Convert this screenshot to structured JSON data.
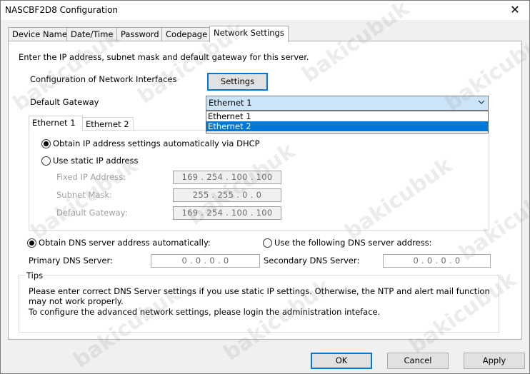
{
  "window": {
    "title": "NASCBF2D8 Configuration",
    "close_glyph": "✕"
  },
  "tabs": [
    {
      "label": "Device Name"
    },
    {
      "label": "Date/Time"
    },
    {
      "label": "Password"
    },
    {
      "label": "Codepage"
    },
    {
      "label": "Network Settings",
      "active": true
    }
  ],
  "network": {
    "intro": "Enter the IP address, subnet mask and default gateway for this server.",
    "interfaces_label": "Configuration of Network Interfaces",
    "settings_button": "Settings",
    "gateway_label": "Default Gateway",
    "gateway_selected": "Ethernet 1",
    "gateway_options": [
      "Ethernet 1",
      "Ethernet 2"
    ],
    "gateway_highlighted": "Ethernet 2"
  },
  "ethernet_tabs": [
    "Ethernet 1",
    "Ethernet 2"
  ],
  "ip_settings": {
    "dhcp_label": "Obtain IP address settings automatically via DHCP",
    "static_label": "Use static IP address",
    "fixed_ip_label": "Fixed IP Address:",
    "subnet_label": "Subnet Mask:",
    "gateway_label": "Default Gateway:",
    "fixed_ip": "169 . 254 . 100 . 100",
    "subnet": "255 . 255 . 0 . 0",
    "gateway": "169 . 254 . 100 . 100"
  },
  "dns": {
    "auto_label": "Obtain DNS server address automatically:",
    "manual_label": "Use the following DNS server address:",
    "primary_label": "Primary DNS Server:",
    "secondary_label": "Secondary DNS Server:",
    "primary": "0 . 0 . 0 . 0",
    "secondary": "0 . 0 . 0 . 0"
  },
  "tips": {
    "title": "Tips",
    "line1": "Please enter correct DNS Server settings if you use static IP settings.  Otherwise, the NTP and alert mail function",
    "line2": "may not work properly.",
    "line3": "To configure the advanced network settings, please login the administration inteface."
  },
  "buttons": {
    "ok": "OK",
    "cancel": "Cancel",
    "apply": "Apply"
  },
  "watermark": "bakicubuk",
  "colors": {
    "accent": "#0078d7",
    "combo_bg": "#cce4f7"
  }
}
